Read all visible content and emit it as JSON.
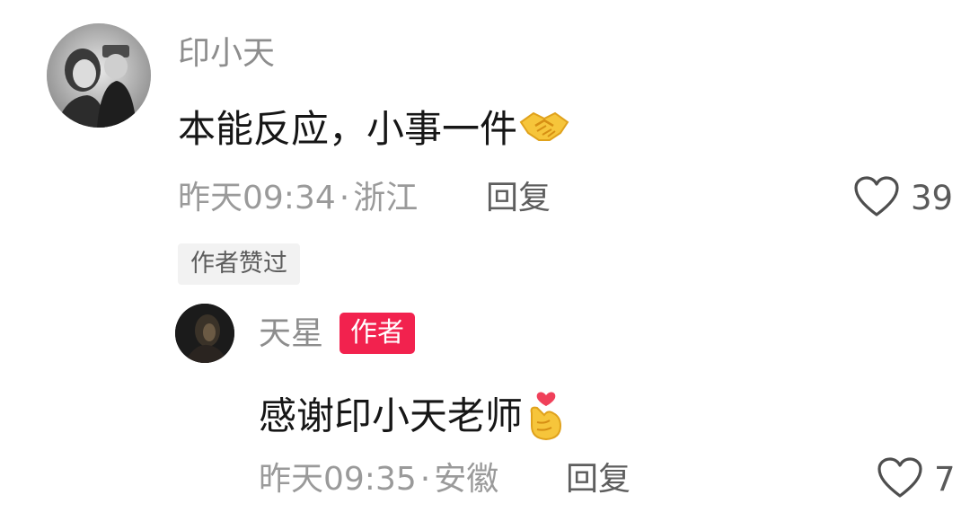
{
  "comments": [
    {
      "username": "印小天",
      "content": "本能反应，小事一件",
      "emoji": "handshake-emoji",
      "time": "昨天09:34",
      "separator": "·",
      "location": "浙江",
      "reply_label": "回复",
      "likes": "39",
      "liked_by_author_label": "作者赞过",
      "avatar": "avatar"
    }
  ],
  "reply": {
    "username": "天星",
    "author_tag": "作者",
    "content": "感谢印小天老师",
    "emoji": "finger-heart-emoji",
    "time": "昨天09:35",
    "separator": "·",
    "location": "安徽",
    "reply_label": "回复",
    "likes": "7",
    "avatar": "avatar"
  },
  "colors": {
    "author_tag_bg": "#f2224e",
    "muted_text": "#9a9a9a",
    "body_text": "#161616"
  }
}
